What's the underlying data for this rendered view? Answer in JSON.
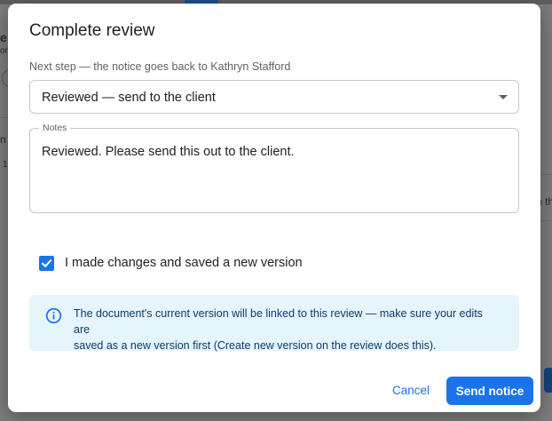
{
  "dialog": {
    "title": "Complete review",
    "next_step_label": "Next step — the notice goes back to Kathryn Stafford",
    "next_step_select": {
      "value": "Reviewed — send to the client"
    },
    "notes": {
      "label": "Notes",
      "value": "Reviewed. Please send this out to the client."
    },
    "checkbox": {
      "label": "I made changes and saved a new version",
      "checked": true
    },
    "info": {
      "line1": "The document's current version will be linked to this review — make sure your edits are",
      "line2": "saved as a new version first (Create new version on the review does this)."
    },
    "buttons": {
      "cancel": "Cancel",
      "send": "Send notice"
    }
  },
  "background_fragments": [
    "e",
    "ord",
    "n",
    "1",
    "n th"
  ],
  "colors": {
    "accent": "#1a73e8",
    "info_bg": "#e6f4fb",
    "info_text": "#0b3d6b"
  },
  "icons": [
    "chevron-down-icon",
    "check-icon",
    "info-icon"
  ]
}
